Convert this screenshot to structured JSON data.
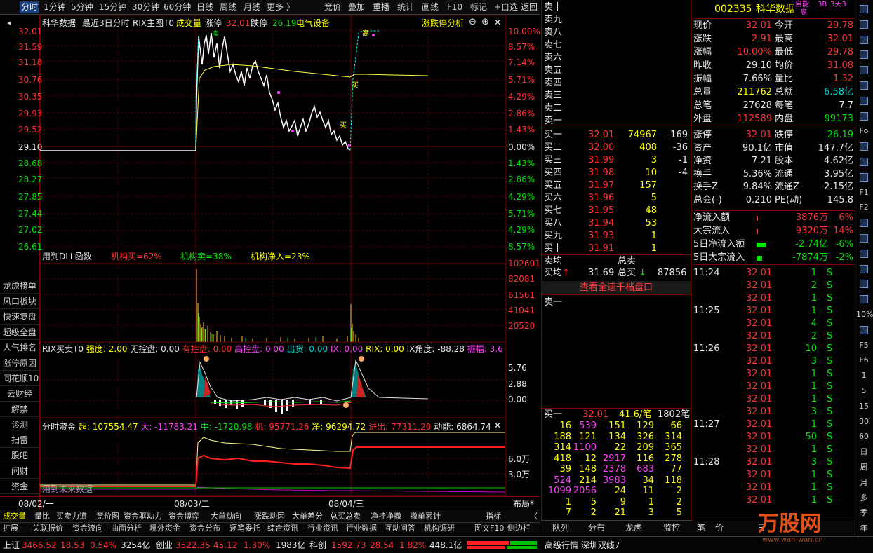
{
  "toolbar": {
    "tabs": [
      "分时",
      "1分钟",
      "5分钟",
      "15分钟",
      "30分钟",
      "60分钟",
      "日线",
      "周线",
      "月线",
      "更多 〉"
    ],
    "right": [
      "竞价",
      "叠加",
      "重播",
      "统计",
      "画线",
      "F10",
      "标记",
      "+自选",
      "返回"
    ]
  },
  "chart_header": {
    "source": "科华数据",
    "period": "最近3日分时",
    "main": "RIX主图T0",
    "vol": "成交量",
    "zt_label": "涨停",
    "zt": "32.01",
    "dt_label": "跌停",
    "dt": "26.19",
    "sector": "电气设备",
    "analysis": "涨跌停分析"
  },
  "price_axis": [
    "32.01",
    "31.59",
    "31.18",
    "30.76",
    "30.35",
    "29.93",
    "29.52",
    "29.10",
    "28.68",
    "28.27",
    "27.85",
    "27.44",
    "27.02",
    "26.61"
  ],
  "pct_axis": [
    "10.00%",
    "8.57%",
    "7.14%",
    "5.71%",
    "4.29%",
    "2.86%",
    "1.43%",
    "0.00%",
    "1.43%",
    "2.86%",
    "4.29%",
    "5.71%",
    "4.29%",
    "8.57%"
  ],
  "dll": {
    "title": "用到DLL函数",
    "a": "机构买=62%",
    "b": "机构卖=38%",
    "c": "机构净入=23%"
  },
  "vol_axis": [
    "102601",
    "82081",
    "61561",
    "41041",
    "20520"
  ],
  "left_menu": [
    "龙虎榜单",
    "风口板块",
    "快速复盘",
    "超级全盘",
    "人气排名",
    "涨停原因",
    "同花顺10",
    "云财经",
    "解禁",
    "诊测",
    "扫雷",
    "股吧",
    "问财",
    "资金"
  ],
  "rix": {
    "title": "RIX买卖T0",
    "items": [
      "强度: 2.00",
      "无控盘: 0.00",
      "有控盘: 0.00",
      "高控盘: 0.00",
      "出货: 0.00",
      "IX: 0.00",
      "RIX: 0.00",
      "IX角度: -88.28",
      "振幅: 3.6",
      "振"
    ],
    "axis": [
      "5.76",
      "2.88",
      "0.00"
    ]
  },
  "fund": {
    "title": "分时资金",
    "super": "超: 107554.47",
    "big": "大: -11783.21",
    "mid": "中: -1720.98",
    "inst": "机: 95771.26",
    "net": "净: 96294.72",
    "inout": "进出: 77311.20",
    "power": "动能: 6864.74",
    "axis": [
      "6.0万",
      "3.0万"
    ],
    "future": "用到未来数据"
  },
  "dates": [
    "08/02/一",
    "08/03/二",
    "08/04/三"
  ],
  "layout_label": "布局*",
  "stock": {
    "code": "002335",
    "name": "科华数据",
    "tag1": "自能",
    "tag2": "3B",
    "tag3": "3天3",
    "tag4": "高"
  },
  "quote": [
    [
      "现价",
      "32.01",
      "今开",
      "29.78"
    ],
    [
      "涨跌",
      "2.91",
      "最高",
      "32.01"
    ],
    [
      "涨幅",
      "10.00%",
      "最低",
      "29.78"
    ],
    [
      "昨收",
      "29.10",
      "均价",
      "31.08"
    ],
    [
      "振幅",
      "7.66%",
      "量比",
      "1.32"
    ],
    [
      "总量",
      "211762",
      "总额",
      "6.58亿"
    ],
    [
      "总笔",
      "27628",
      "每笔",
      "7.7"
    ],
    [
      "外盘",
      "112589",
      "内盘",
      "99173"
    ]
  ],
  "quote2": [
    [
      "涨停",
      "32.01",
      "跌停",
      "26.19"
    ],
    [
      "资产",
      "90.1亿",
      "市值",
      "147.7亿"
    ],
    [
      "净资",
      "7.21",
      "股本",
      "4.62亿"
    ],
    [
      "换手",
      "5.36%",
      "流通",
      "3.95亿"
    ],
    [
      "换手Z",
      "9.84%",
      "流通Z",
      "2.15亿"
    ],
    [
      "总会(-)",
      "0.210",
      "PE(动)",
      "145.8"
    ]
  ],
  "flow": [
    [
      "净流入额",
      "3876万",
      "6%"
    ],
    [
      "大宗流入",
      "9320万",
      "14%"
    ],
    [
      "5日净流入额",
      "-2.74亿",
      "-6%"
    ],
    [
      "5日大宗流入",
      "-7874万",
      "-2%"
    ]
  ],
  "sell_labels": [
    "卖十",
    "卖九",
    "卖八",
    "卖七",
    "卖六",
    "卖五",
    "卖四",
    "卖三",
    "卖二",
    "卖一"
  ],
  "buy": [
    [
      "买一",
      "32.01",
      "74967",
      "-169"
    ],
    [
      "买二",
      "32.00",
      "408",
      "-36"
    ],
    [
      "买三",
      "31.99",
      "3",
      "-1"
    ],
    [
      "买四",
      "31.98",
      "10",
      "-4"
    ],
    [
      "买五",
      "31.97",
      "157",
      ""
    ],
    [
      "买六",
      "31.96",
      "5",
      ""
    ],
    [
      "买七",
      "31.95",
      "48",
      ""
    ],
    [
      "买八",
      "31.94",
      "53",
      ""
    ],
    [
      "买九",
      "31.93",
      "1",
      ""
    ],
    [
      "买十",
      "31.91",
      "1",
      ""
    ]
  ],
  "avg": {
    "l1": "卖均",
    "l2": "总卖",
    "l3": "买均",
    "v3": "31.69",
    "l4": "总买",
    "v4": "87856"
  },
  "full_depth": "查看全速千档盘口",
  "sell1": "卖一",
  "buy1": {
    "label": "买一",
    "price": "32.01",
    "per": "41.6/笔",
    "count": "1802笔"
  },
  "queue": [
    [
      "16",
      "539",
      "151",
      "129",
      "66"
    ],
    [
      "188",
      "121",
      "134",
      "326",
      "314"
    ],
    [
      "314",
      "1100",
      "22",
      "209",
      "365"
    ],
    [
      "418",
      "12",
      "2917",
      "116",
      "278"
    ],
    [
      "39",
      "148",
      "2378",
      "683",
      "77"
    ],
    [
      "524",
      "214",
      "3983",
      "34",
      "118"
    ],
    [
      "1099",
      "2056",
      "24",
      "11",
      "2"
    ],
    [
      "1",
      "5",
      "9",
      "1",
      "2"
    ],
    [
      "7",
      "2",
      "21",
      "3",
      "5"
    ]
  ],
  "ticks": [
    {
      "t": "11:24",
      "p": "32.01",
      "v": "1",
      "s": "S"
    },
    {
      "t": "",
      "p": "32.01",
      "v": "2",
      "s": "S"
    },
    {
      "t": "",
      "p": "32.01",
      "v": "1",
      "s": "S"
    },
    {
      "t": "11:25",
      "p": "32.01",
      "v": "1",
      "s": "S"
    },
    {
      "t": "",
      "p": "32.01",
      "v": "4",
      "s": "S"
    },
    {
      "t": "",
      "p": "32.01",
      "v": "2",
      "s": "S"
    },
    {
      "t": "11:26",
      "p": "32.01",
      "v": "10",
      "s": "S"
    },
    {
      "t": "",
      "p": "32.01",
      "v": "3",
      "s": "S"
    },
    {
      "t": "",
      "p": "32.01",
      "v": "1",
      "s": "S"
    },
    {
      "t": "",
      "p": "32.01",
      "v": "1",
      "s": "S"
    },
    {
      "t": "",
      "p": "32.01",
      "v": "1",
      "s": "S"
    },
    {
      "t": "",
      "p": "32.01",
      "v": "3",
      "s": "S"
    },
    {
      "t": "11:27",
      "p": "32.01",
      "v": "1",
      "s": "S"
    },
    {
      "t": "",
      "p": "32.01",
      "v": "50",
      "s": "S"
    },
    {
      "t": "",
      "p": "32.01",
      "v": "1",
      "s": "S"
    },
    {
      "t": "11:28",
      "p": "32.01",
      "v": "3",
      "s": "S"
    },
    {
      "t": "",
      "p": "32.01",
      "v": "1",
      "s": "S"
    },
    {
      "t": "",
      "p": "32.01",
      "v": "1",
      "s": "S"
    },
    {
      "t": "",
      "p": "32.01",
      "v": "1",
      "s": "S"
    }
  ],
  "right_tools": [
    "",
    "",
    "",
    "",
    "",
    "",
    "",
    "",
    "Fo",
    "",
    "",
    "",
    "F1",
    "F2",
    "",
    "",
    "",
    "",
    "",
    "",
    "10%",
    "",
    "F5",
    "F6",
    "1",
    "5",
    "15",
    "30",
    "60",
    "日",
    "周",
    "月",
    "多",
    "季",
    "年"
  ],
  "bottom_tabs1": [
    "成交量",
    "量比",
    "买卖力道",
    "竞价图",
    "资金驱动力",
    "资金博弈",
    "大单动向",
    "涨跌动因",
    "大单差分",
    "总买总卖",
    "净挂净撤",
    "撤单累计",
    "指标",
    "〈"
  ],
  "bottom_tabs2": [
    "扩展",
    "关联报价",
    "资金流向",
    "曲面分析",
    "境外资金",
    "资金分布",
    "逐笔委托",
    "综合资讯",
    "行业资讯",
    "行业数据",
    "互动问答",
    "机构调研",
    "图文F10",
    "侧边栏"
  ],
  "bottom_right": [
    "队列",
    "分布",
    "龙虎",
    "监控",
    "笔",
    "价",
    "日"
  ],
  "status": "高级行情   深圳双线7",
  "index_bar": [
    {
      "name": "上证",
      "val": "3466.52",
      "chg": "18.53",
      "pct": "0.54%",
      "amt": "3254亿"
    },
    {
      "name": "创业",
      "val": "3522.35",
      "chg": "45.12",
      "pct": "1.30%",
      "amt": "1983亿"
    },
    {
      "name": "科创",
      "val": "1592.73",
      "chg": "28.54",
      "pct": "1.82%",
      "amt": "448.1亿"
    }
  ],
  "watermark": "万股网",
  "watermark_url": "www.wan-wan.cn"
}
